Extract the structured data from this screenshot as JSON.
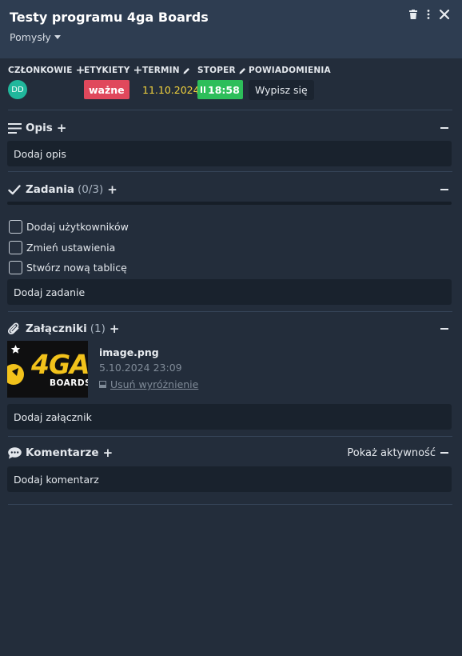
{
  "card": {
    "title": "Testy programu 4ga Boards",
    "list_name": "Pomysły"
  },
  "header_icons": [
    "trash-icon",
    "more-vertical-icon",
    "close-icon"
  ],
  "attributes": {
    "members": {
      "label": "CZŁONKOWIE",
      "avatar_initials": "DD",
      "avatar_color": "#20b79c"
    },
    "labels": {
      "label": "ETYKIETY",
      "chip": "ważne",
      "chip_color": "#e0485c"
    },
    "due": {
      "label": "TERMIN",
      "value": "11.10.2024",
      "color": "#f3d33c"
    },
    "stopwatch": {
      "label": "STOPER",
      "value": "18:58",
      "color": "#2dbe5a"
    },
    "notifications": {
      "label": "POWIADOMIENIA",
      "button": "Wypisz się"
    }
  },
  "description": {
    "title": "Opis",
    "placeholder": "Dodaj opis"
  },
  "tasks": {
    "title": "Zadania",
    "count": "(0/3)",
    "progress": 0,
    "items": [
      {
        "label": "Dodaj użytkowników",
        "checked": false
      },
      {
        "label": "Zmień ustawienia",
        "checked": false
      },
      {
        "label": "Stwórz nową tablicę",
        "checked": false
      }
    ],
    "add_label": "Dodaj zadanie"
  },
  "attachments": {
    "title": "Załączniki",
    "count": "(1)",
    "item": {
      "name": "image.png",
      "date": "5.10.2024 23:09",
      "cover_action": "Usuń wyróżnienie",
      "thumb_text_main": "4GA",
      "thumb_text_sub": "BOARDS"
    },
    "add_label": "Dodaj załącznik"
  },
  "comments": {
    "title": "Komentarze",
    "activity_label": "Pokaż aktywność",
    "add_label": "Dodaj komentarz"
  }
}
